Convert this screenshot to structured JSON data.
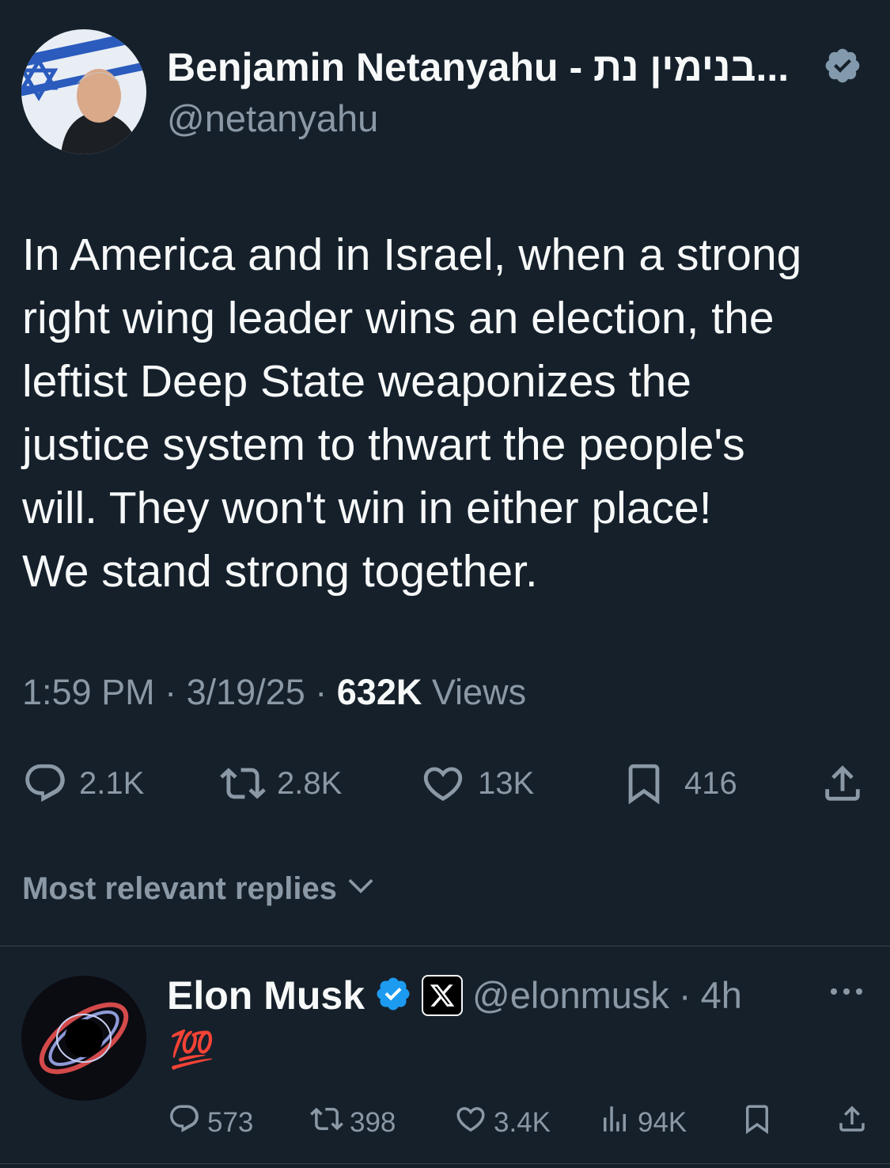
{
  "tweet": {
    "author_name": "Benjamin Netanyahu - בנימין נת...",
    "author_handle": "@netanyahu",
    "text_lines": [
      "In America and in Israel, when a strong",
      "right wing leader wins an election, the",
      "leftist Deep State weaponizes the",
      "justice system to thwart the people's",
      "will. They won't win in either place!",
      "We stand strong together."
    ],
    "time": "1:59 PM",
    "date": "3/19/25",
    "views_count": "632K",
    "views_label": "Views",
    "replies": "2.1K",
    "reposts": "2.8K",
    "likes": "13K",
    "bookmarks": "416"
  },
  "replies_section": {
    "label": "Most relevant replies"
  },
  "reply": {
    "author_name": "Elon Musk",
    "author_handle": "@elonmusk",
    "age": "4h",
    "text": "💯",
    "replies": "573",
    "reposts": "398",
    "likes": "3.4K",
    "views": "94K"
  },
  "colors": {
    "background": "#15202b",
    "muted": "#8b98a5",
    "verified_gray": "#829aab",
    "verified_blue": "#1d9bf0"
  }
}
